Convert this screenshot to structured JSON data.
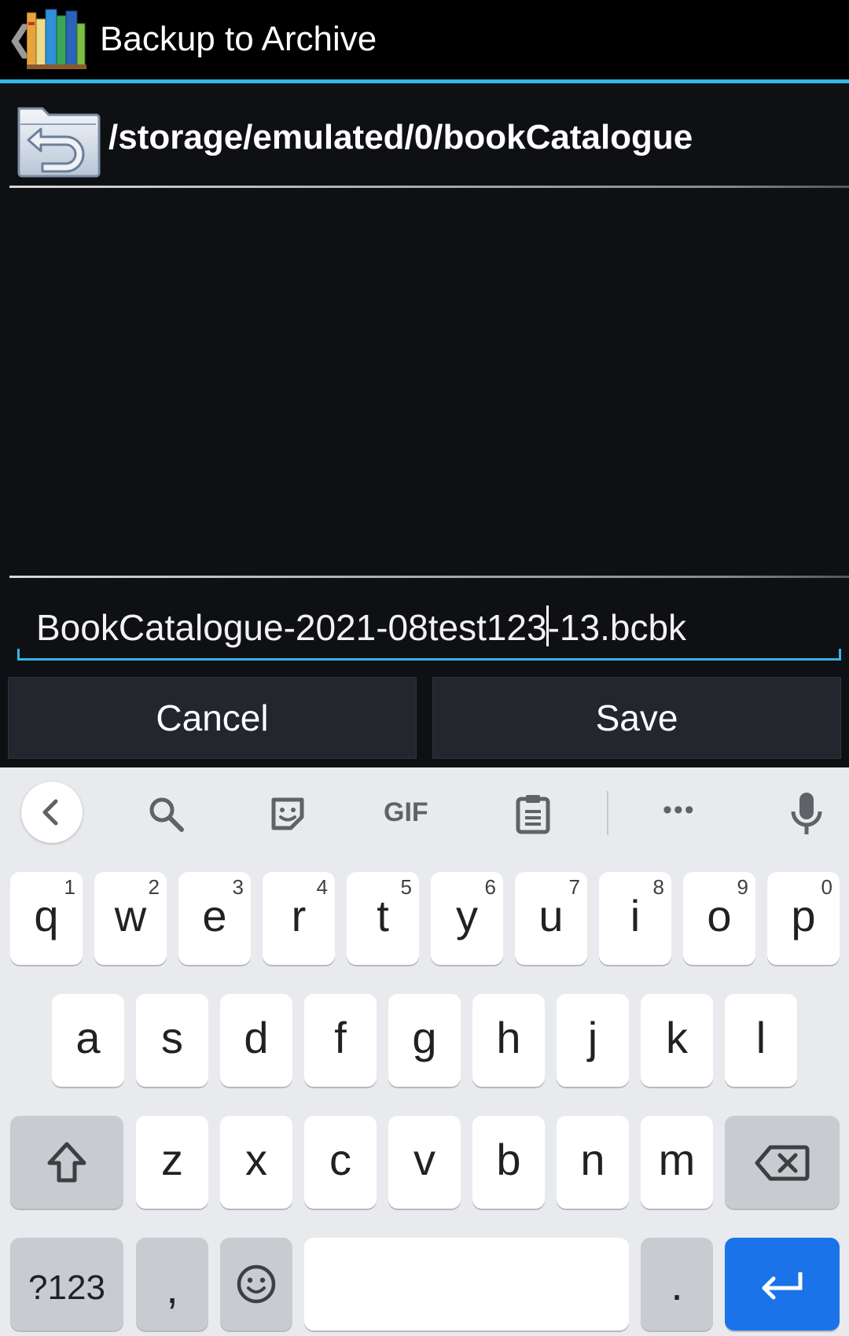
{
  "actionbar": {
    "title": "Backup to Archive",
    "up_glyph": "❮",
    "app_icon": "book-catalogue-app-icon"
  },
  "path_row": {
    "icon": "folder-up-icon",
    "path": "/storage/emulated/0/bookCatalogue"
  },
  "filename": {
    "before_cursor": "BookCatalogue-2021-08test123",
    "after_cursor": "-13.bcbk"
  },
  "buttons": {
    "cancel": "Cancel",
    "save": "Save"
  },
  "keyboard": {
    "toolbar_icons": [
      "chevron-left-icon",
      "search-icon",
      "sticker-icon",
      "gif-icon",
      "clipboard-icon",
      "more-icon",
      "mic-icon"
    ],
    "gif_label": "GIF",
    "more_label": "•••",
    "row1": [
      {
        "ch": "q",
        "hint": "1"
      },
      {
        "ch": "w",
        "hint": "2"
      },
      {
        "ch": "e",
        "hint": "3"
      },
      {
        "ch": "r",
        "hint": "4"
      },
      {
        "ch": "t",
        "hint": "5"
      },
      {
        "ch": "y",
        "hint": "6"
      },
      {
        "ch": "u",
        "hint": "7"
      },
      {
        "ch": "i",
        "hint": "8"
      },
      {
        "ch": "o",
        "hint": "9"
      },
      {
        "ch": "p",
        "hint": "0"
      }
    ],
    "row2": [
      "a",
      "s",
      "d",
      "f",
      "g",
      "h",
      "j",
      "k",
      "l"
    ],
    "row3": [
      "z",
      "x",
      "c",
      "v",
      "b",
      "n",
      "m"
    ],
    "symbols_label": "?123",
    "comma": ",",
    "period": ".",
    "accent_color": "#1a73e8"
  }
}
